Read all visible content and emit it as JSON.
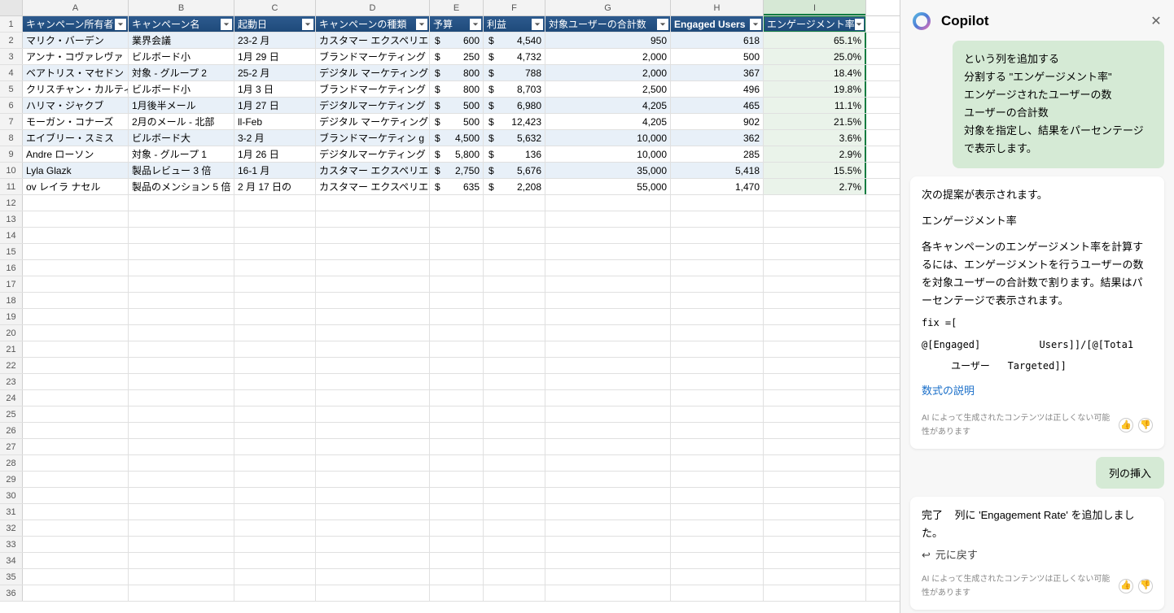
{
  "columns": [
    "A",
    "B",
    "C",
    "D",
    "E",
    "F",
    "G",
    "H",
    "I"
  ],
  "headers": {
    "A": "キャンペーン所有者",
    "B": "キャンペーン名",
    "C": "起動日",
    "D": "キャンペーンの種類",
    "E": "予算",
    "F": "利益",
    "G": "対象ユーザーの合計数",
    "H": "Engaged Users",
    "I": "エンゲージメント率"
  },
  "rows": [
    {
      "owner": "マリク・バーデン",
      "name": "業界会議",
      "date": "23-2 月",
      "type": "カスタマー エクスペリエンス",
      "budget": "600",
      "profit": "4,540",
      "target": "950",
      "engaged": "618",
      "rate": "65.1%"
    },
    {
      "owner": "アンナ・コヴァレヴァ",
      "name": "ビルボード小",
      "date": "1月 29 日",
      "type": "ブランドマーケティング",
      "budget": "250",
      "profit": "4,732",
      "target": "2,000",
      "engaged": "500",
      "rate": "25.0%"
    },
    {
      "owner": "ベアトリス・マセドン",
      "name": "対象 - グループ 2",
      "date": "25-2 月",
      "type": "デジタル マーケティング",
      "budget": "800",
      "profit": "788",
      "target": "2,000",
      "engaged": "367",
      "rate": "18.4%"
    },
    {
      "owner": "クリスチャン・カルティエ",
      "name": "ビルボード小",
      "date": "1月 3 日",
      "type": "ブランドマーケティング",
      "budget": "800",
      "profit": "8,703",
      "target": "2,500",
      "engaged": "496",
      "rate": "19.8%"
    },
    {
      "owner": "ハリマ・ジャクブ",
      "name": "1月後半メール",
      "date": "1月 27 日",
      "type": "デジタルマーケティング",
      "budget": "500",
      "profit": "6,980",
      "target": "4,205",
      "engaged": "465",
      "rate": "11.1%"
    },
    {
      "owner": "モーガン・コナーズ",
      "name": "2月のメール - 北部",
      "date": "ll-Feb",
      "type": "デジタル マーケティング",
      "budget": "500",
      "profit": "12,423",
      "target": "4,205",
      "engaged": "902",
      "rate": "21.5%"
    },
    {
      "owner": "エイブリー・スミス",
      "name": "ビルボード大",
      "date": "3-2 月",
      "type": "ブランドマーケティン g",
      "budget": "4,500",
      "profit": "5,632",
      "target": "10,000",
      "engaged": "362",
      "rate": "3.6%"
    },
    {
      "owner": "Andre ローソン",
      "name": "対象 - グループ 1",
      "date": "1月 26 日",
      "type": "デジタルマーケティング",
      "budget": "5,800",
      "profit": "136",
      "target": "10,000",
      "engaged": "285",
      "rate": "2.9%"
    },
    {
      "owner": "Lyla Glazk",
      "name": "製品レビュー 3 倍",
      "date": "16-1 月",
      "type": "カスタマー エクスペリエンス",
      "budget": "2,750",
      "profit": "5,676",
      "target": "35,000",
      "engaged": "5,418",
      "rate": "15.5%"
    },
    {
      "owner": "ov レイラ ナセル",
      "name": "製品のメンション 5 倍",
      "date": "2 月 17 日の",
      "type": "カスタマー エクスペリエンス",
      "budget": "635",
      "profit": "2,208",
      "target": "55,000",
      "engaged": "1,470",
      "rate": "2.7%"
    }
  ],
  "emptyRows": 25,
  "copilot": {
    "title": "Copilot",
    "userBubble": {
      "l1": "という列を追加する",
      "l2": "分割する \"エンゲージメント率\"",
      "l3": "エンゲージされたユーザーの数",
      "l4": "ユーザーの合計数",
      "l5": "対象を指定し、結果をパーセンテージで表示します。"
    },
    "assist1": {
      "lead": "次の提案が表示されます。",
      "title": "エンゲージメント率",
      "body": "各キャンペーンのエンゲージメント率を計算するには、エンゲージメントを行うユーザーの数を対象ユーザーの合計数で割ります。結果はパーセンテージで表示されます。",
      "fix": "fix =[",
      "f1a": "@[Engaged]",
      "f1b": "Users]]/[@[Tota1",
      "f2a": "ユーザー",
      "f2b": "Targeted]]",
      "explain": "数式の説明",
      "disclaimer": "AI によって生成されたコンテンツは正しくない可能性があります"
    },
    "insertBtn": "列の挿入",
    "assist2": {
      "done": "完了",
      "msg": "列に 'Engagement Rate' を追加しました。",
      "undo": "元に戻す",
      "disclaimer": "AI によって生成されたコンテンツは正しくない可能性があります"
    }
  }
}
